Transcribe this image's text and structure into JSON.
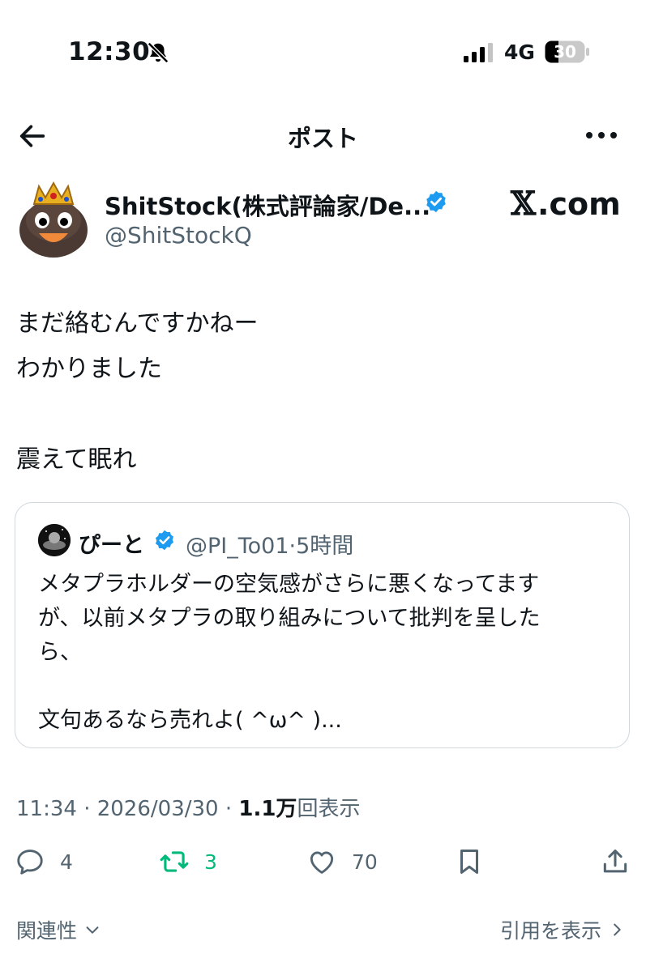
{
  "status_bar": {
    "time": "12:30",
    "network": "4G",
    "battery": "30"
  },
  "header": {
    "title": "ポスト"
  },
  "author": {
    "display_name": "ShitStock(株式評論家/De...",
    "handle": "@ShitStockQ"
  },
  "watermark": {
    "x": "𝕏",
    "text": ".com"
  },
  "tweet": {
    "lines": [
      "まだ絡むんですかねー",
      "わかりました",
      "",
      "震えて眠れ"
    ]
  },
  "quote": {
    "name": "ぴーと",
    "handle_time": "@PI_To01·5時間",
    "lines": [
      "メタプラホルダーの空気感がさらに悪くなってます",
      "が、以前メタプラの取り組みについて批判を呈した",
      "ら、",
      "",
      "文句あるなら売れよ( ^ω^ )..."
    ]
  },
  "meta": {
    "time_date": "11:34 · 2026/03/30 · ",
    "views_count": "1.1万",
    "views_label": "回表示"
  },
  "actions": {
    "replies": "4",
    "retweets": "3",
    "likes": "70"
  },
  "footer": {
    "related": "関連性",
    "view_quotes": "引用を表示"
  },
  "colors": {
    "accent": "#1d9bf0",
    "retweet_green": "#00ba7c",
    "muted": "#536471",
    "text": "#0f1419"
  },
  "icons": [
    "bell-off-icon",
    "signal-icon",
    "battery-icon",
    "back-arrow-icon",
    "more-icon",
    "verified-icon",
    "reply-icon",
    "retweet-icon",
    "like-icon",
    "bookmark-icon",
    "share-icon",
    "chevron-down-icon",
    "chevron-right-icon"
  ]
}
